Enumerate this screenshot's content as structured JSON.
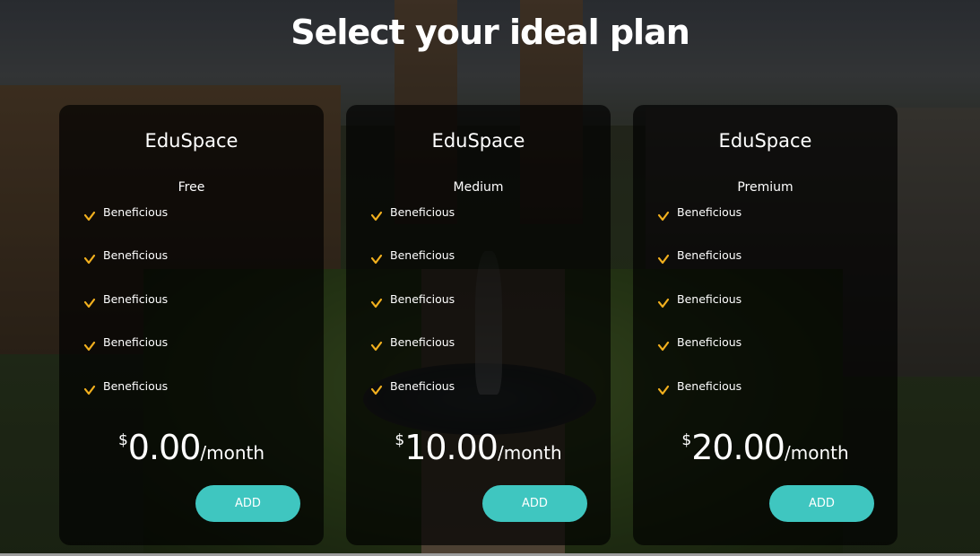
{
  "page": {
    "title": "Select your ideal plan"
  },
  "colors": {
    "accent": "#3fc6c0",
    "check": "#f2b01e",
    "card_bg": "rgba(0,0,0,0.68)",
    "text": "#ffffff"
  },
  "plans": [
    {
      "brand": "EduSpace",
      "tier": "Free",
      "features": [
        "Beneficious",
        "Beneficious",
        "Beneficious",
        "Beneficious",
        "Beneficious"
      ],
      "currency": "$",
      "amount": "0.00",
      "period": "/month",
      "button_label": "ADD"
    },
    {
      "brand": "EduSpace",
      "tier": "Medium",
      "features": [
        "Beneficious",
        "Beneficious",
        "Beneficious",
        "Beneficious",
        "Beneficious"
      ],
      "currency": "$",
      "amount": "10.00",
      "period": "/month",
      "button_label": "ADD"
    },
    {
      "brand": "EduSpace",
      "tier": "Premium",
      "features": [
        "Beneficious",
        "Beneficious",
        "Beneficious",
        "Beneficious",
        "Beneficious"
      ],
      "currency": "$",
      "amount": "20.00",
      "period": "/month",
      "button_label": "ADD"
    }
  ],
  "icons": {
    "feature": "check-icon"
  }
}
